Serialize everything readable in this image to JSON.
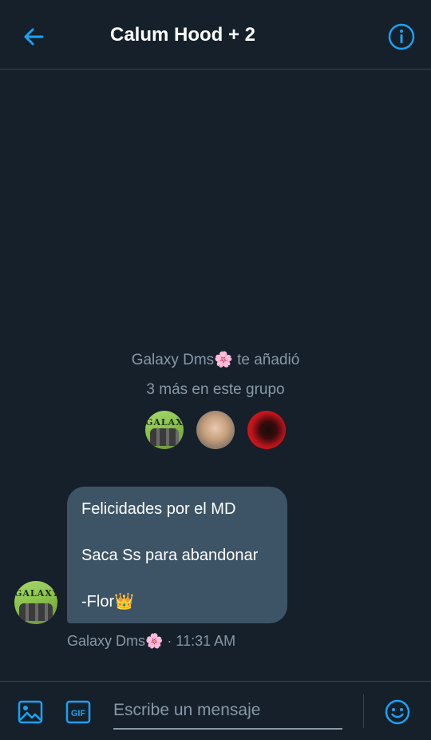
{
  "header": {
    "title": "Calum Hood + 2",
    "back_icon": "arrow-left-icon",
    "info_icon": "info-icon"
  },
  "system_message": {
    "line1": "Galaxy Dms🌸 te añadió",
    "line2": "3 más en este grupo"
  },
  "added_avatars": [
    {
      "label": "GALAXY"
    },
    {
      "label": ""
    },
    {
      "label": ""
    }
  ],
  "message": {
    "line1": "Felicidades por el MD",
    "line2": "Saca Ss para abandonar",
    "line3": "-Flor👑",
    "sender": "Galaxy Dms🌸",
    "time": "11:31 AM",
    "meta": "Galaxy Dms🌸 · 11:31 AM"
  },
  "sender_avatar_label": "GALAXY",
  "composer": {
    "placeholder": "Escribe un mensaje",
    "gif_label": "GIF"
  },
  "colors": {
    "background": "#15202b",
    "accent": "#1da1f2",
    "bubble": "#3d5466",
    "muted_text": "#8899a6",
    "border": "#38444d"
  }
}
